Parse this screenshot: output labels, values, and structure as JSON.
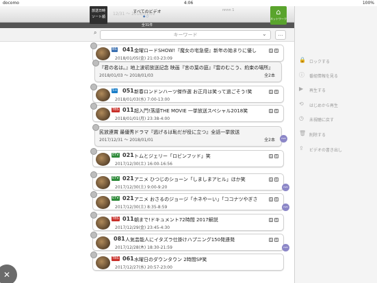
{
  "status_bar": {
    "carrier": "docomo",
    "time": "4:06",
    "battery": "100%"
  },
  "header": {
    "title": "すべてのビデオ",
    "ghost_left": "12/31 ～ 2018/01/01",
    "ghost_right": "nnnn 1",
    "sort_button": [
      "放送日時",
      "ソート順"
    ],
    "network_button": "ネットワーク"
  },
  "count_label": "全31件",
  "search": {
    "placeholder": "キーワード",
    "more": "…"
  },
  "programs": [
    {
      "type": "item",
      "thumb": "dark",
      "channel_tag": "BS",
      "channel_num": "041",
      "title": "金曜ロードSHOW!『魔女の宅急便』新年の始まりに優しさと…",
      "date": "2018/01/05(金) 21:03-23:09",
      "icons": true
    },
    {
      "type": "group",
      "title": "『君の名は。』地上波初放送記念 映画『言の葉の庭』『雲のむこう、約束の場所』",
      "date": "2018/01/03 ～ 2018/01/03",
      "count": "全2本"
    },
    {
      "type": "item",
      "thumb": "dark",
      "channel_tag": "5+",
      "channel_num": "051",
      "title": "新春ロンドンハーツ傑作選 お正月は笑って過ごそう!笑",
      "date": "2018/01/03(水) 7:00-13:00",
      "icons": true
    },
    {
      "type": "item",
      "thumb": "dark",
      "channel_tag": "TBS",
      "channel_num": "011",
      "title": "超入門!落語THE MOVIE 一挙放送スペシャル2018笑",
      "date": "2018/01/01(月) 23:38-4:00",
      "icons": true
    },
    {
      "type": "group",
      "title": "民放連賞 最優秀ドラマ『逃げるは恥だが役に立つ』全話一挙放送",
      "date": "2017/12/31 ～ 2018/01/01",
      "count": "全2本",
      "tag": "DVD"
    },
    {
      "type": "item",
      "thumb": "dark",
      "channel_tag": "ETV",
      "channel_num": "021",
      "title": "トムとジェリー「ロビンフッド」笑",
      "date": "2017/12/30(土) 16:00-16:56",
      "icons": true
    },
    {
      "type": "item",
      "thumb": "dark",
      "channel_tag": "ETV",
      "channel_num": "021",
      "title": "アニメ ひつじのショーン「しましまアヒル」ほか笑",
      "date": "2017/12/30(土) 9:00-9:20",
      "icons": true,
      "tag": "DVD"
    },
    {
      "type": "item",
      "thumb": "dark",
      "channel_tag": "ETV",
      "channel_num": "021",
      "title": "アニメ おさるのジョージ「ホネやーい」「ココナツやぎさん…",
      "date": "2017/12/30(土) 8:35-8:59",
      "icons": true,
      "tag": "DVD"
    },
    {
      "type": "item",
      "thumb": "dark",
      "channel_tag": "TBS",
      "channel_num": "011",
      "title": "朝まで!ドキュメント72時間 2017解説",
      "date": "2017/12/29(金) 23:45-4:30",
      "icons": true
    },
    {
      "type": "item",
      "thumb": "dark",
      "channel_tag": "",
      "channel_num": "081",
      "title": "人気芸能人にイタズラ仕掛けハプニング150発連発",
      "date": "2017/12/28(木) 18:30-21:59",
      "icons": true,
      "tag": "DVD"
    },
    {
      "type": "item",
      "thumb": "dark",
      "channel_tag": "TBS",
      "channel_num": "061",
      "title": "水曜日のダウンタウン 2時間SP笑",
      "date": "2017/12/27(水) 20:57-23:00",
      "icons": false
    }
  ],
  "side_menu": [
    {
      "icon": "lock-icon",
      "glyph": "🔒",
      "label": "ロックする"
    },
    {
      "icon": "info-icon",
      "glyph": "ⓘ",
      "label": "番組情報を見る"
    },
    {
      "icon": "play-icon",
      "glyph": "▶",
      "label": "再生する"
    },
    {
      "icon": "restart-icon",
      "glyph": "⟲",
      "label": "はじめから再生"
    },
    {
      "icon": "unwatched-icon",
      "glyph": "◷",
      "label": "未視聴に戻す"
    },
    {
      "icon": "trash-icon",
      "glyph": "🗑",
      "label": "削除する"
    },
    {
      "icon": "export-icon",
      "glyph": "⇪",
      "label": "ビデオの書き出し"
    }
  ],
  "close_button": "✕",
  "colors": {
    "accent_green": "#5aa42d",
    "dvd_tag": "#8b86c7",
    "sort_bg": "#2f2f2f"
  }
}
